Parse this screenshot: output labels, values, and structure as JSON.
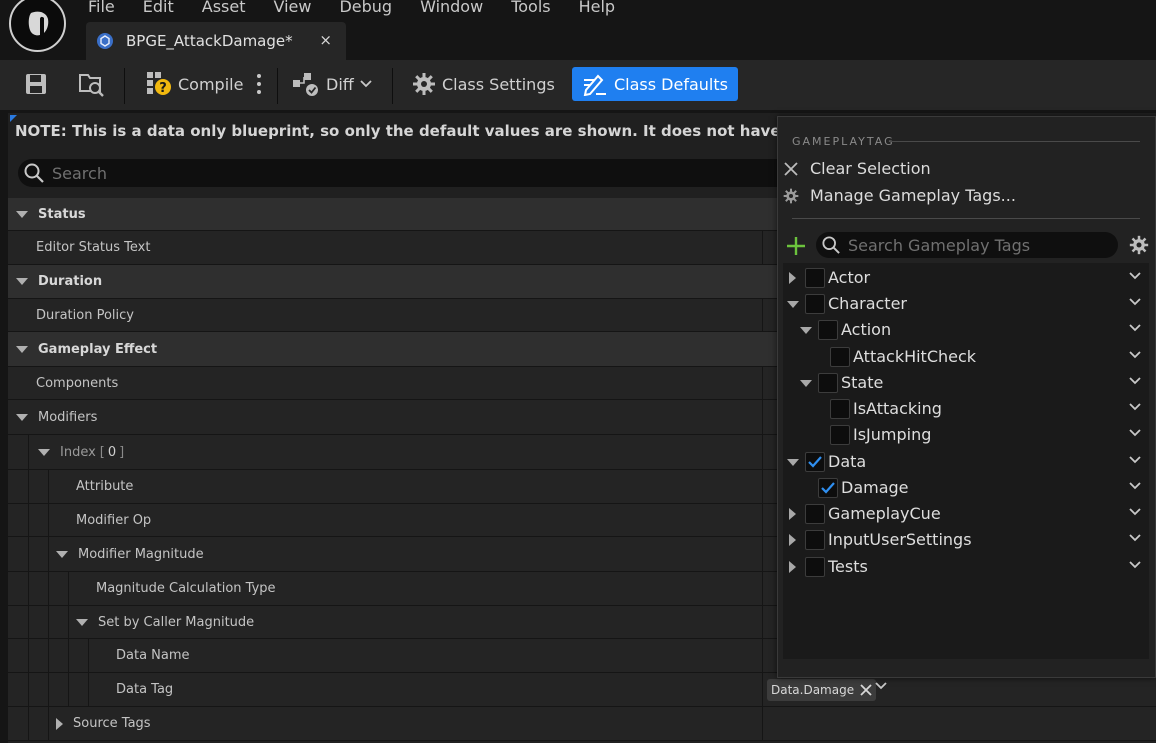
{
  "menu": [
    "File",
    "Edit",
    "Asset",
    "View",
    "Debug",
    "Window",
    "Tools",
    "Help"
  ],
  "document_tab": {
    "title": "BPGE_AttackDamage*",
    "close": "×"
  },
  "toolbar": {
    "compile_label": "Compile",
    "diff_label": "Diff",
    "class_settings_label": "Class Settings",
    "class_defaults_label": "Class Defaults"
  },
  "details": {
    "note": "NOTE: This is a data only blueprint, so only the default values are shown.  It does not have any script or variables.",
    "search_placeholder": "Search",
    "rows": {
      "status": "Status",
      "editor_status_text": "Editor Status Text",
      "duration": "Duration",
      "duration_policy": "Duration Policy",
      "gameplay_effect": "Gameplay Effect",
      "components": "Components",
      "modifiers": "Modifiers",
      "index_label": "Index",
      "index_open": "[",
      "index_value": "0",
      "index_close": "]",
      "attribute": "Attribute",
      "modifier_op": "Modifier Op",
      "modifier_magnitude": "Modifier Magnitude",
      "magnitude_calculation_type": "Magnitude Calculation Type",
      "set_by_caller_magnitude": "Set by Caller Magnitude",
      "data_name": "Data Name",
      "data_tag": "Data Tag",
      "source_tags": "Source Tags"
    },
    "data_tag_value": "Data.Damage"
  },
  "tag_popup": {
    "section": "GAMEPLAYTAG",
    "clear_selection": "Clear Selection",
    "manage_tags": "Manage Gameplay Tags...",
    "search_placeholder": "Search Gameplay Tags",
    "tree": {
      "actor": "Actor",
      "character": "Character",
      "action": "Action",
      "attack_hit_check": "AttackHitCheck",
      "state": "State",
      "is_attacking": "IsAttacking",
      "is_jumping": "IsJumping",
      "data": "Data",
      "damage": "Damage",
      "gameplay_cue": "GameplayCue",
      "input_user_settings": "InputUserSettings",
      "tests": "Tests"
    },
    "accent_check": "#2f8ff0",
    "add_color": "#6cc33d"
  },
  "accent": "#1f7ff0"
}
